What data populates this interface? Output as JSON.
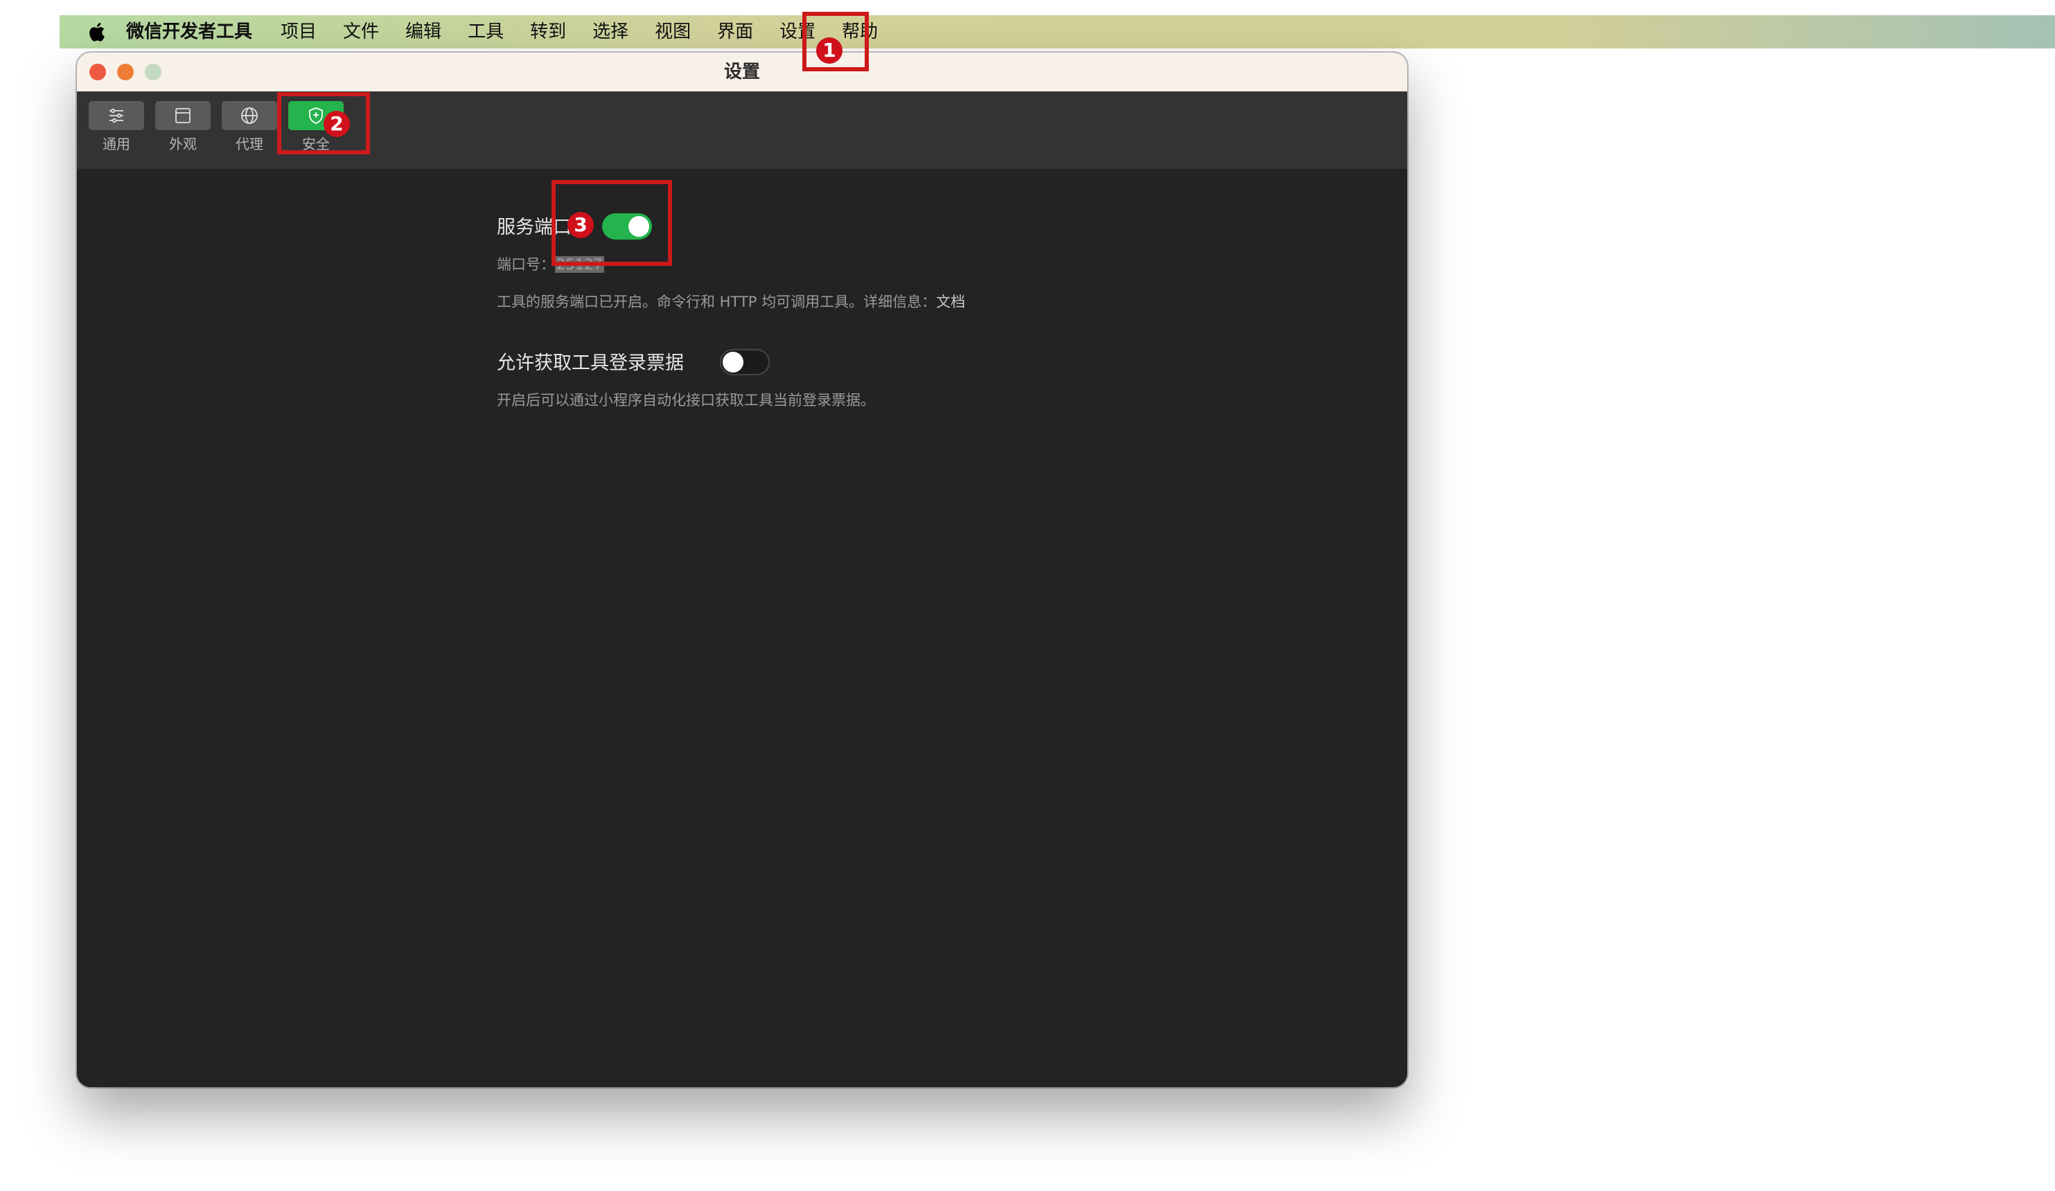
{
  "menubar": {
    "app_name": "微信开发者工具",
    "items": [
      "项目",
      "文件",
      "编辑",
      "工具",
      "转到",
      "选择",
      "视图",
      "界面",
      "设置",
      "帮助"
    ]
  },
  "window": {
    "title": "设置"
  },
  "toolbar": {
    "tabs": [
      {
        "label": "通用",
        "icon": "sliders-icon",
        "active": false
      },
      {
        "label": "外观",
        "icon": "layout-icon",
        "active": false
      },
      {
        "label": "代理",
        "icon": "globe-icon",
        "active": false
      },
      {
        "label": "安全",
        "icon": "shield-icon",
        "active": true
      }
    ]
  },
  "security": {
    "service_port_label": "服务端口",
    "service_port_enabled": true,
    "port_number_label": "端口号：",
    "port_number_value": "25127",
    "service_port_desc": "工具的服务端口已开启。命令行和 HTTP 均可调用工具。详细信息：",
    "doc_link": "文档",
    "login_ticket_label": "允许获取工具登录票据",
    "login_ticket_enabled": false,
    "login_ticket_desc": "开启后可以通过小程序自动化接口获取工具当前登录票据。"
  },
  "annotations": {
    "badge_1": "1",
    "badge_2": "2",
    "badge_3": "3",
    "color": "#cc1a1a"
  },
  "colors": {
    "accent_green": "#24b34c",
    "window_bg": "#222222"
  }
}
